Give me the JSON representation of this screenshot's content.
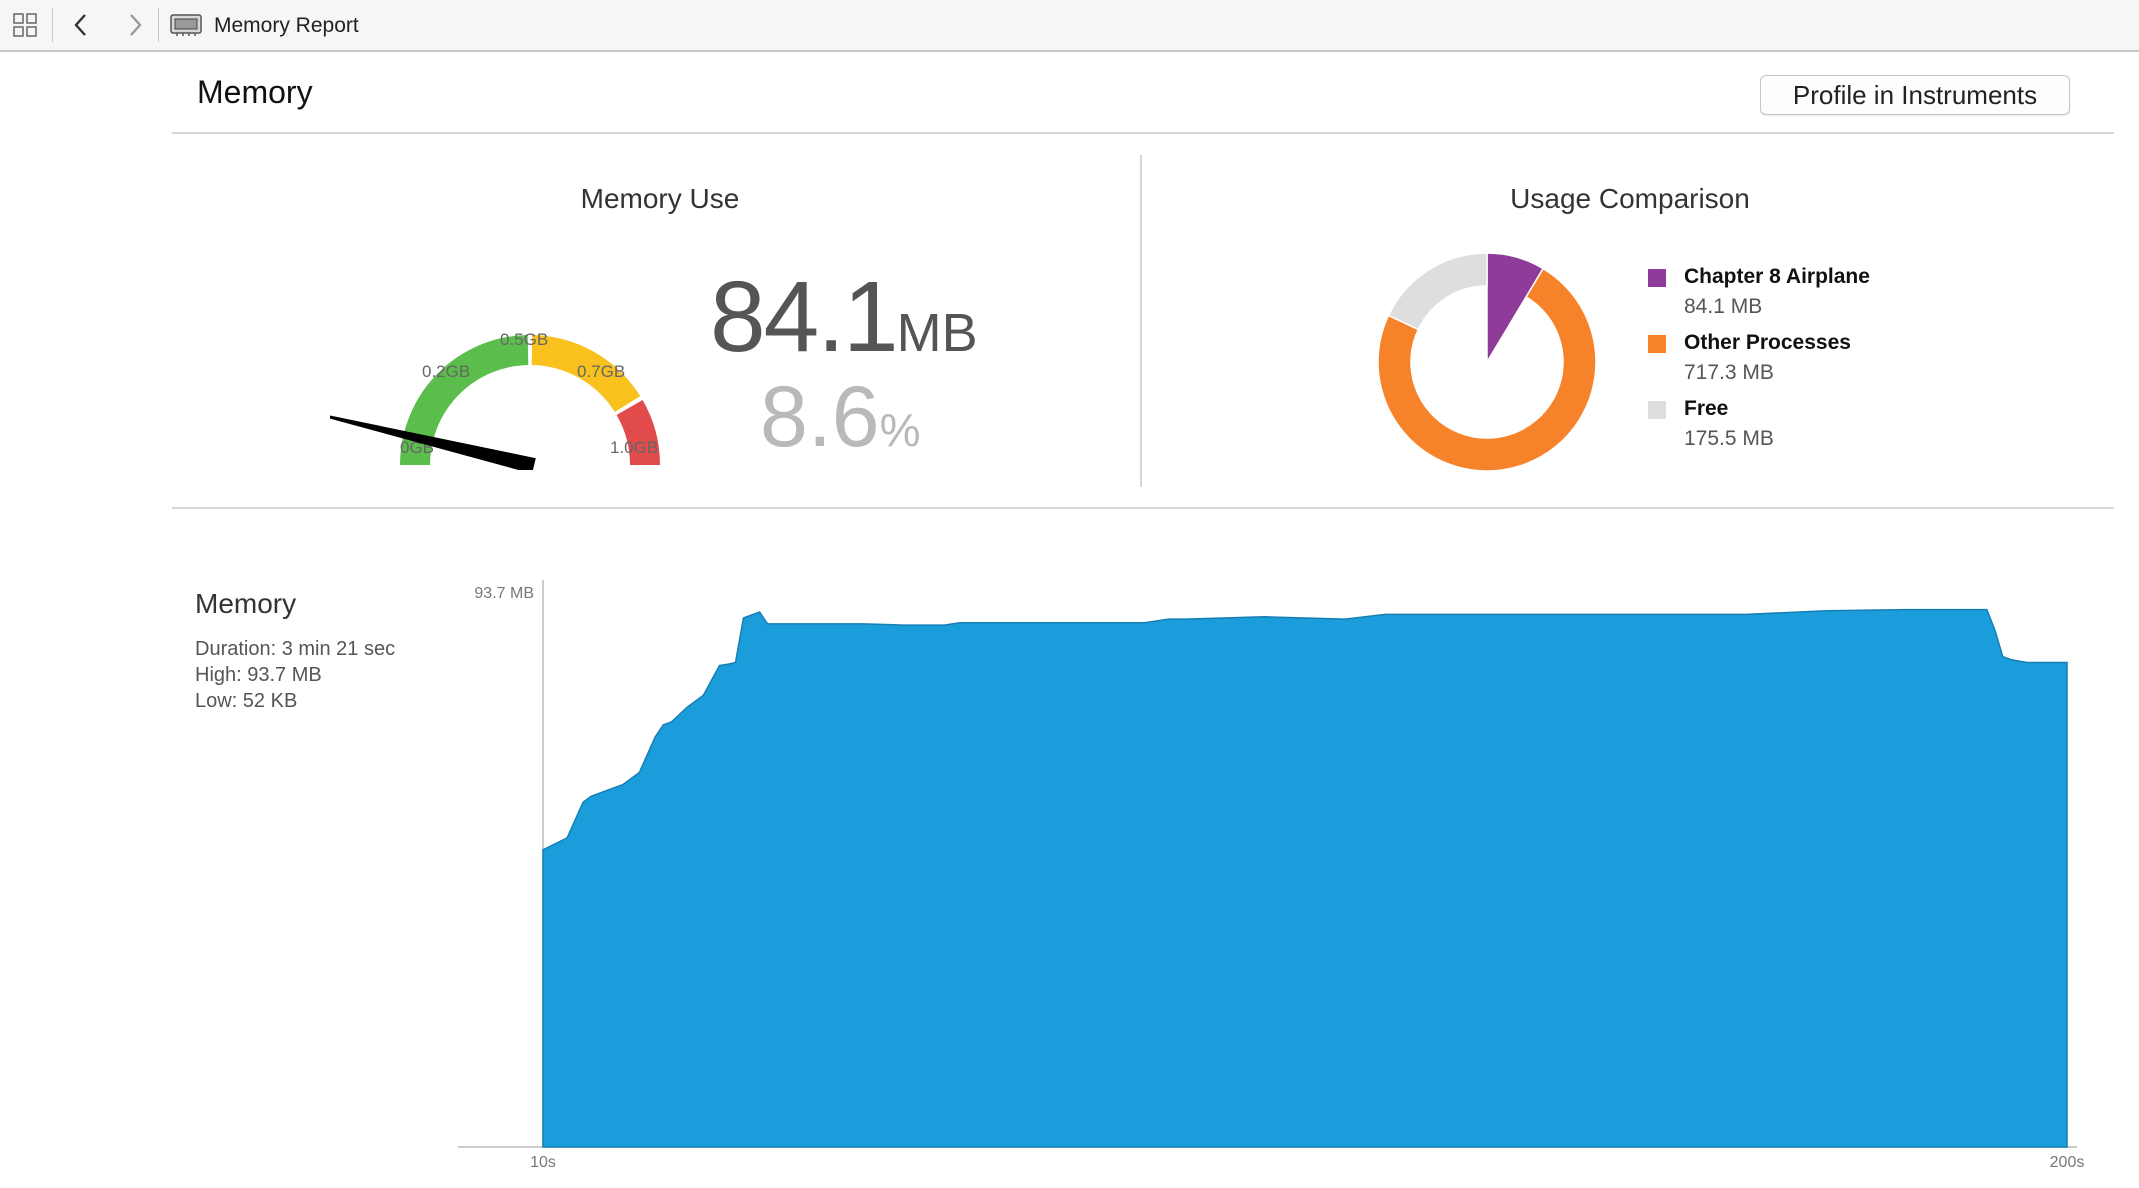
{
  "toolbar": {
    "breadcrumb_label": "Memory Report",
    "icons": [
      "grid-icon",
      "chevron-left-icon",
      "chevron-right-icon",
      "memory-chip-icon"
    ]
  },
  "header": {
    "title": "Memory",
    "profile_button": "Profile in Instruments"
  },
  "memory_use": {
    "title": "Memory Use",
    "value": "84.1",
    "value_unit": "MB",
    "percent": "8.6",
    "percent_unit": "%",
    "gauge_labels": [
      "0GB",
      "0.2GB",
      "0.5GB",
      "0.7GB",
      "1.0GB"
    ],
    "gauge_needle_fraction": 0.086,
    "colors": {
      "green": "#5bbd4b",
      "yellow": "#f8c11d",
      "red": "#e14b4b"
    }
  },
  "usage_comparison": {
    "title": "Usage Comparison",
    "items": [
      {
        "name": "Chapter 8 Airplane",
        "value": "84.1 MB",
        "mb": 84.1,
        "color": "#8f3b99"
      },
      {
        "name": "Other Processes",
        "value": "717.3 MB",
        "mb": 717.3,
        "color": "#f6822a"
      },
      {
        "name": "Free",
        "value": "175.5 MB",
        "mb": 175.5,
        "color": "#dedede"
      }
    ]
  },
  "memory_chart": {
    "title": "Memory",
    "duration": "Duration: 3 min 21 sec",
    "high": "High: 93.7 MB",
    "low": "Low: 52 KB"
  },
  "chart_data": {
    "type": "area",
    "title": "",
    "xlabel": "",
    "ylabel": "",
    "y_max_label": "93.7 MB",
    "x_tick_labels": [
      "10s",
      "200s"
    ],
    "xlim": [
      10,
      200
    ],
    "ylim": [
      0,
      93.7
    ],
    "color": "#1b9ddb",
    "x": [
      10,
      13,
      14,
      15,
      16,
      18,
      20,
      22,
      24,
      25,
      26,
      28,
      30,
      32,
      33,
      34,
      35,
      37,
      38,
      39,
      40,
      41,
      42,
      45,
      50,
      55,
      60,
      62,
      65,
      70,
      75,
      80,
      85,
      88,
      90,
      100,
      110,
      115,
      120,
      130,
      140,
      150,
      160,
      170,
      180,
      187,
      190,
      191,
      192,
      193,
      195,
      198,
      200
    ],
    "y": [
      50,
      52,
      55,
      58,
      59,
      60,
      61,
      63,
      69,
      71,
      71.5,
      74,
      76,
      81,
      81.2,
      81.5,
      89,
      90,
      88,
      88,
      88,
      88,
      88,
      88,
      88,
      87.8,
      87.8,
      88.2,
      88.2,
      88.2,
      88.2,
      88.2,
      88.2,
      88.8,
      88.8,
      89.2,
      88.8,
      89.6,
      89.6,
      89.6,
      89.6,
      89.6,
      89.6,
      90.2,
      90.4,
      90.4,
      90.4,
      87,
      82.5,
      82,
      81.5,
      81.5,
      81.5
    ]
  }
}
